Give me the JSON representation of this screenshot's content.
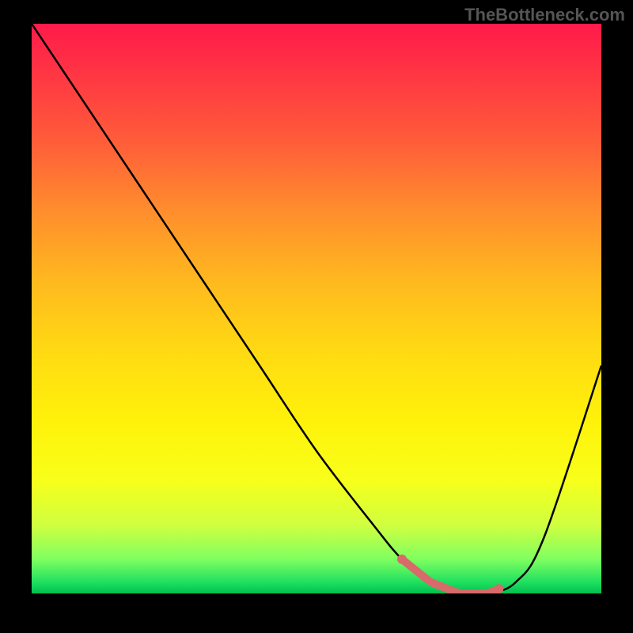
{
  "watermark": "TheBottleneck.com",
  "chart_data": {
    "type": "line",
    "title": "",
    "xlabel": "",
    "ylabel": "",
    "xlim": [
      0,
      100
    ],
    "ylim": [
      0,
      100
    ],
    "series": [
      {
        "name": "bottleneck-curve",
        "x": [
          0,
          10,
          20,
          30,
          40,
          50,
          60,
          65,
          70,
          75,
          80,
          85,
          90,
          100
        ],
        "values": [
          100,
          85,
          70,
          55,
          40,
          25,
          12,
          6,
          2,
          0,
          0,
          2,
          10,
          40
        ]
      }
    ],
    "gradient_stops": [
      {
        "pos": 0,
        "color": "#ff1a4a"
      },
      {
        "pos": 20,
        "color": "#ff5a3a"
      },
      {
        "pos": 45,
        "color": "#ffb81f"
      },
      {
        "pos": 70,
        "color": "#fff20a"
      },
      {
        "pos": 88,
        "color": "#d0ff40"
      },
      {
        "pos": 100,
        "color": "#00c050"
      }
    ],
    "optimal_region_x": [
      65,
      82
    ],
    "optimal_marker_color": "#d96a6a"
  }
}
